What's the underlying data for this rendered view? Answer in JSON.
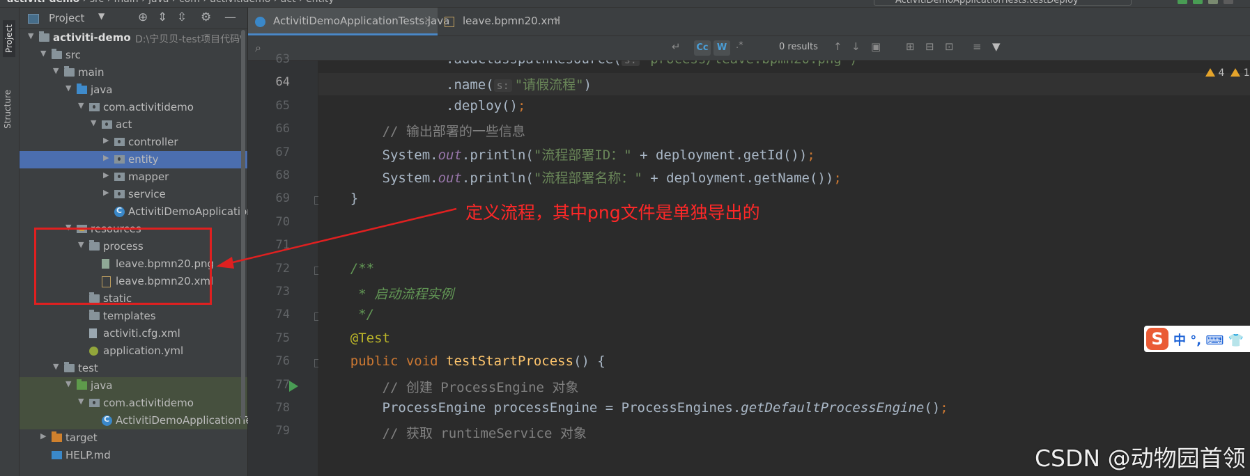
{
  "breadcrumbs": [
    "activiti-demo",
    "src",
    "main",
    "java",
    "com",
    "activitidemo",
    "act",
    "entity"
  ],
  "run_config": "ActivitiDemoApplicationTests.testDeploy",
  "left_strip": {
    "project": "Project",
    "structure": "Structure"
  },
  "project_panel": {
    "title": "Project",
    "tree": [
      {
        "label": "activiti-demo",
        "extra": "D:\\宁贝贝-test项目代码\\",
        "depth": 0,
        "icon": "module-folder-icon",
        "expanded": true,
        "bold": true
      },
      {
        "label": "src",
        "depth": 1,
        "icon": "folder-icon",
        "expanded": true
      },
      {
        "label": "main",
        "depth": 2,
        "icon": "folder-icon",
        "expanded": true
      },
      {
        "label": "java",
        "depth": 3,
        "icon": "source-folder-icon",
        "expanded": true
      },
      {
        "label": "com.activitidemo",
        "depth": 4,
        "icon": "package-icon",
        "expanded": true
      },
      {
        "label": "act",
        "depth": 5,
        "icon": "package-icon",
        "expanded": true
      },
      {
        "label": "controller",
        "depth": 6,
        "icon": "package-icon",
        "expanded": false
      },
      {
        "label": "entity",
        "depth": 6,
        "icon": "package-icon",
        "expanded": false,
        "selected": true
      },
      {
        "label": "mapper",
        "depth": 6,
        "icon": "package-icon",
        "expanded": false
      },
      {
        "label": "service",
        "depth": 6,
        "icon": "package-icon",
        "expanded": false
      },
      {
        "label": "ActivitiDemoApplication",
        "depth": 6,
        "icon": "class-icon",
        "leaf": true
      },
      {
        "label": "resources",
        "depth": 3,
        "icon": "resources-folder-icon",
        "expanded": true
      },
      {
        "label": "process",
        "depth": 4,
        "icon": "folder-icon",
        "expanded": true
      },
      {
        "label": "leave.bpmn20.png",
        "depth": 5,
        "icon": "png-file-icon",
        "leaf": true
      },
      {
        "label": "leave.bpmn20.xml",
        "depth": 5,
        "icon": "bpmn-file-icon",
        "leaf": true
      },
      {
        "label": "static",
        "depth": 4,
        "icon": "folder-icon",
        "leaf": true
      },
      {
        "label": "templates",
        "depth": 4,
        "icon": "folder-icon",
        "leaf": true
      },
      {
        "label": "activiti.cfg.xml",
        "depth": 4,
        "icon": "xml-file-icon",
        "leaf": true
      },
      {
        "label": "application.yml",
        "depth": 4,
        "icon": "yml-file-icon",
        "leaf": true
      },
      {
        "label": "test",
        "depth": 2,
        "icon": "folder-icon",
        "expanded": true
      },
      {
        "label": "java",
        "depth": 3,
        "icon": "test-source-folder-icon",
        "expanded": true,
        "test": true
      },
      {
        "label": "com.activitidemo",
        "depth": 4,
        "icon": "package-icon",
        "expanded": true,
        "test": true
      },
      {
        "label": "ActivitiDemoApplicationTests",
        "depth": 5,
        "icon": "class-icon",
        "leaf": true,
        "test": true
      },
      {
        "label": "target",
        "depth": 1,
        "icon": "excluded-folder-icon",
        "expanded": false
      },
      {
        "label": "HELP.md",
        "depth": 1,
        "icon": "md-file-icon",
        "leaf": true
      }
    ]
  },
  "tabs": [
    {
      "label": "ActivitiDemoApplicationTests.java",
      "active": true,
      "icon": "java-class-icon"
    },
    {
      "label": "leave.bpmn20.xml",
      "active": false,
      "icon": "bpmn-file-icon"
    }
  ],
  "find_bar": {
    "results": "0 results",
    "match_case": "Cc",
    "words": "W",
    "regex": ".*"
  },
  "editor": {
    "current_line": 64,
    "warnings": "4",
    "warnings2": "1",
    "lines": [
      {
        "num": "63",
        "parts": [
          {
            "t": "                .addClasspathResource(",
            "c": ""
          },
          {
            "t": "s:",
            "c": "hint"
          },
          {
            "t": "\"process/leave.bpmn20.png\")",
            "c": "str"
          }
        ]
      },
      {
        "num": "64",
        "parts": [
          {
            "t": "                .name(",
            "c": ""
          },
          {
            "t": "s:",
            "c": "hint"
          },
          {
            "t": "\"请假流程\"",
            "c": "str"
          },
          {
            "t": ")",
            "c": ""
          }
        ]
      },
      {
        "num": "65",
        "parts": [
          {
            "t": "                .deploy()",
            "c": ""
          },
          {
            "t": ";",
            "c": "kw"
          }
        ]
      },
      {
        "num": "66",
        "parts": [
          {
            "t": "        // 输出部署的一些信息",
            "c": "cm"
          }
        ]
      },
      {
        "num": "67",
        "parts": [
          {
            "t": "        System.",
            "c": ""
          },
          {
            "t": "out",
            "c": "static"
          },
          {
            "t": ".println(",
            "c": ""
          },
          {
            "t": "\"流程部署ID：\"",
            "c": "str"
          },
          {
            "t": " + deployment.getId())",
            "c": ""
          },
          {
            "t": ";",
            "c": "kw"
          }
        ]
      },
      {
        "num": "68",
        "parts": [
          {
            "t": "        System.",
            "c": ""
          },
          {
            "t": "out",
            "c": "static"
          },
          {
            "t": ".println(",
            "c": ""
          },
          {
            "t": "\"流程部署名称：\"",
            "c": "str"
          },
          {
            "t": " + deployment.getName())",
            "c": ""
          },
          {
            "t": ";",
            "c": "kw"
          }
        ]
      },
      {
        "num": "69",
        "parts": [
          {
            "t": "    }",
            "c": ""
          }
        ]
      },
      {
        "num": "70",
        "parts": []
      },
      {
        "num": "71",
        "parts": []
      },
      {
        "num": "72",
        "parts": [
          {
            "t": "    /**",
            "c": "doc"
          }
        ]
      },
      {
        "num": "73",
        "parts": [
          {
            "t": "     * 启动流程实例",
            "c": "doc"
          }
        ]
      },
      {
        "num": "74",
        "parts": [
          {
            "t": "     */",
            "c": "doc"
          }
        ]
      },
      {
        "num": "75",
        "parts": [
          {
            "t": "    @Test",
            "c": "ann"
          }
        ]
      },
      {
        "num": "76",
        "parts": [
          {
            "t": "    public void ",
            "c": "kw"
          },
          {
            "t": "testStartProcess",
            "c": "fn"
          },
          {
            "t": "() {",
            "c": ""
          }
        ]
      },
      {
        "num": "77",
        "parts": [
          {
            "t": "        // 创建 ProcessEngine 对象",
            "c": "cm"
          }
        ]
      },
      {
        "num": "78",
        "parts": [
          {
            "t": "        ProcessEngine processEngine = ProcessEngines.",
            "c": ""
          },
          {
            "t": "getDefaultProcessEngine",
            "c": "it"
          },
          {
            "t": "()",
            "c": ""
          },
          {
            "t": ";",
            "c": "kw"
          }
        ]
      },
      {
        "num": "79",
        "parts": [
          {
            "t": "        // 获取 runtimeService 对象",
            "c": "cm"
          }
        ]
      }
    ]
  },
  "annotation": {
    "text": "定义流程，其中png文件是单独导出的",
    "color": "#ff2828"
  },
  "ime": {
    "logo": "S",
    "text": "中 °, ⌨ 👕"
  },
  "watermark": "CSDN @动物园首领",
  "colors": {
    "background": "#2b2b2b",
    "panel": "#3c3f41",
    "selection": "#4b6eaf",
    "accent": "#4a88c7"
  }
}
